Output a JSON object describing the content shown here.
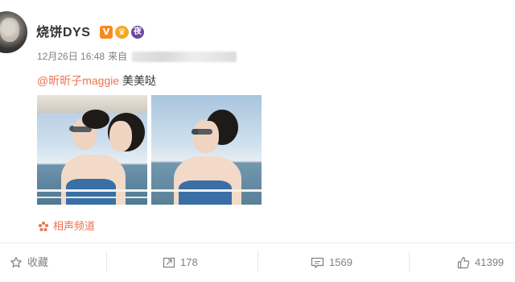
{
  "post": {
    "username": "烧饼DYS",
    "badges": {
      "v": "V",
      "night": "夜"
    },
    "date": "12月26日 16:48",
    "source_prefix": "来自",
    "mention": "@昕昕子maggie",
    "text": " 美美哒",
    "topic_tag": "相声频道"
  },
  "actions": {
    "favorite": "收藏",
    "repost": "178",
    "comment": "1569",
    "like": "41399"
  },
  "colors": {
    "accent": "#eb7350",
    "verified": "#f78b1f"
  }
}
